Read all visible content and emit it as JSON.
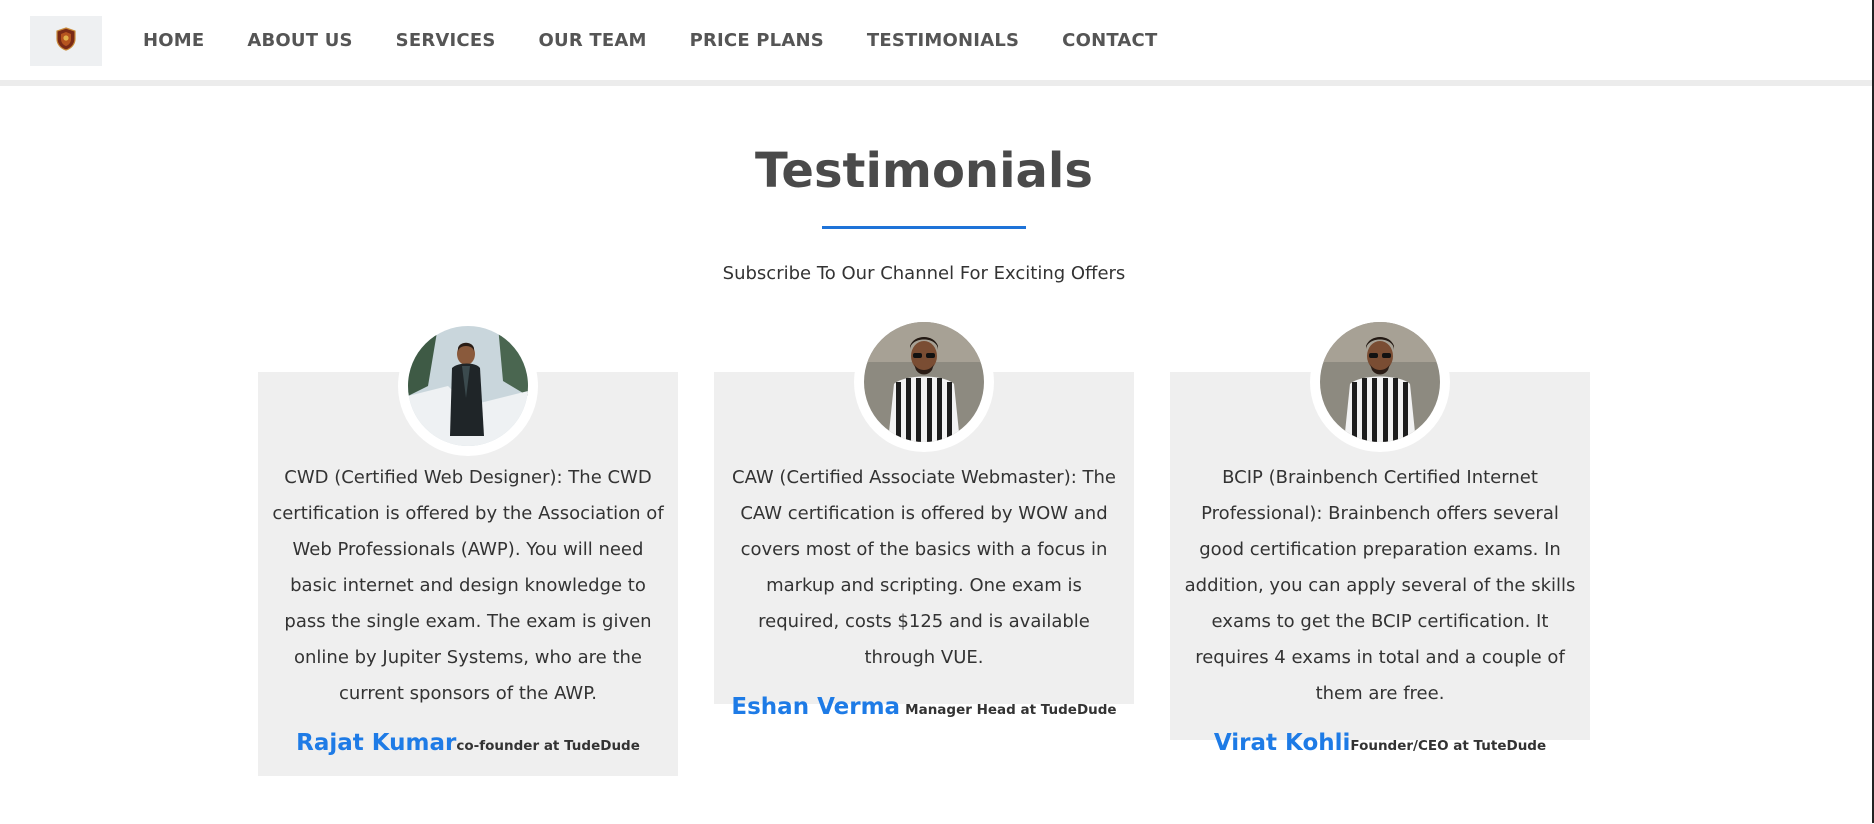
{
  "nav": {
    "logo_icon": "shield-crest-icon",
    "items": [
      {
        "label": "HOME"
      },
      {
        "label": "ABOUT US"
      },
      {
        "label": "SERVICES"
      },
      {
        "label": "OUR TEAM"
      },
      {
        "label": "PRICE PLANS"
      },
      {
        "label": "TESTIMONIALS"
      },
      {
        "label": "CONTACT"
      }
    ]
  },
  "section": {
    "title": "Testimonials",
    "subtitle": "Subscribe To Our Channel For Exciting Offers",
    "accent_color": "#1e73d8"
  },
  "testimonials": [
    {
      "text": "CWD (Certified Web Designer): The CWD certification is offered by the Association of Web Professionals (AWP). You will need basic internet and design knowledge to pass the single exam. The exam is given online by Jupiter Systems, who are the current sponsors of the AWP.",
      "name": "Rajat Kumar",
      "role": "co-founder at TudeDude"
    },
    {
      "text": "CAW (Certified Associate Webmaster): The CAW certification is offered by WOW and covers most of the basics with a focus in markup and scripting. One exam is required, costs $125 and is available through VUE.",
      "name": "Eshan Verma",
      "role": "Manager Head at TudeDude"
    },
    {
      "text": "BCIP (Brainbench Certified Internet Professional): Brainbench offers several good certification preparation exams. In addition, you can apply several of the skills exams to get the BCIP certification. It requires 4 exams in total and a couple of them are free.",
      "name": "Virat Kohli",
      "role": "Founder/CEO at TuteDude"
    }
  ],
  "colors": {
    "name_link": "#1e7be6",
    "card_background": "#efefef"
  }
}
